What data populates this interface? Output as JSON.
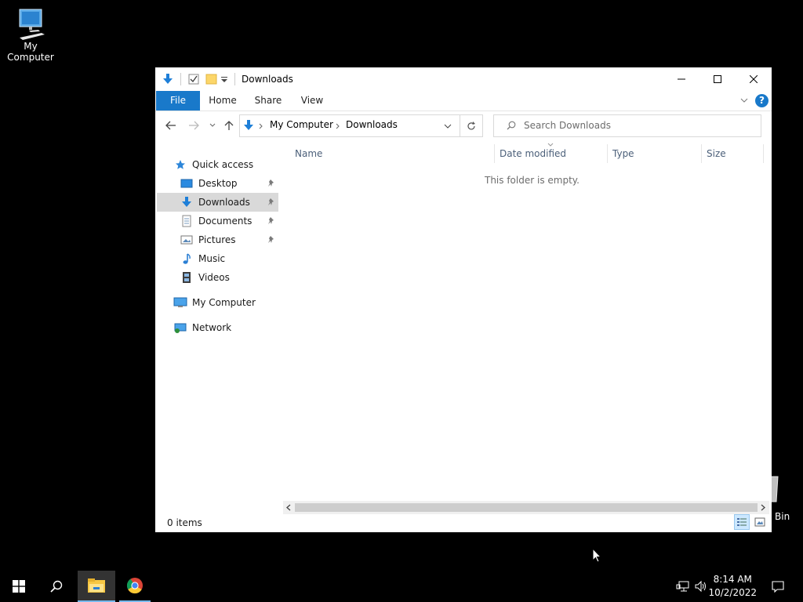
{
  "desktop": {
    "icons": [
      {
        "label": "My Computer",
        "icon": "computer-icon"
      },
      {
        "label": "Bin",
        "icon": "recycle-bin-icon"
      }
    ]
  },
  "window": {
    "title": "Downloads",
    "ribbon_tabs": [
      "File",
      "Home",
      "Share",
      "View"
    ],
    "address": {
      "segments": [
        "My Computer",
        "Downloads"
      ]
    },
    "search": {
      "placeholder": "Search Downloads"
    },
    "sidebar": {
      "quick_access": "Quick access",
      "pinned": [
        {
          "label": "Desktop",
          "icon": "desktop-icon",
          "pinned": true
        },
        {
          "label": "Downloads",
          "icon": "downloads-icon",
          "pinned": true,
          "selected": true
        },
        {
          "label": "Documents",
          "icon": "documents-icon",
          "pinned": true
        },
        {
          "label": "Pictures",
          "icon": "pictures-icon",
          "pinned": true
        },
        {
          "label": "Music",
          "icon": "music-icon",
          "pinned": false
        },
        {
          "label": "Videos",
          "icon": "videos-icon",
          "pinned": false
        }
      ],
      "my_computer": "My Computer",
      "network": "Network"
    },
    "columns": [
      "Name",
      "Date modified",
      "Type",
      "Size"
    ],
    "empty_message": "This folder is empty.",
    "status": "0 items"
  },
  "taskbar": {
    "time": "8:14 AM",
    "date": "10/2/2022"
  },
  "colors": {
    "accent": "#1979ca",
    "selected": "#d9d9d9",
    "desktop": "#000000"
  }
}
